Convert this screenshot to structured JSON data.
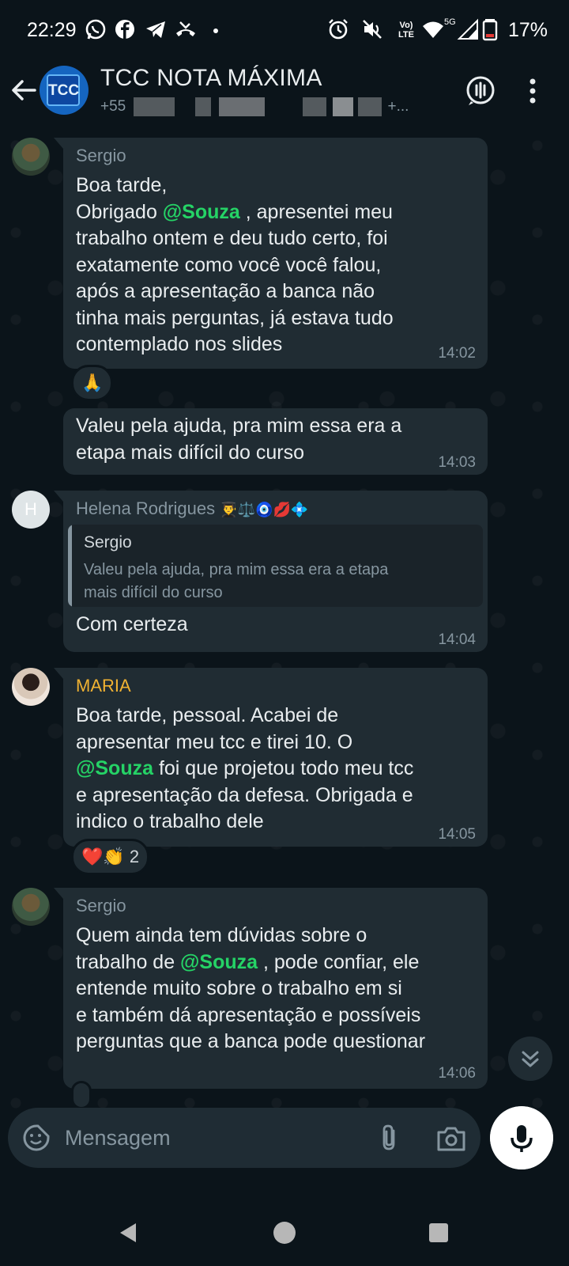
{
  "status_bar": {
    "time": "22:29",
    "battery": "17%",
    "network_label": "Vo) LTE",
    "network_5g": "5G",
    "icons": [
      "whatsapp-icon",
      "facebook-icon",
      "telegram-icon",
      "missed-call-icon",
      "dot-icon",
      "alarm-icon",
      "mute-icon",
      "volte-icon",
      "wifi-icon",
      "signal-icon",
      "battery-icon"
    ]
  },
  "header": {
    "back_icon": "arrow-left-icon",
    "avatar_text": "TCC",
    "title": "TCC NOTA MÁXIMA",
    "members_start": "+55 ",
    "members_end": "+...",
    "call_icon": "voice-call-icon",
    "menu_icon": "more-vertical-icon"
  },
  "messages": [
    {
      "sender": "Sergio",
      "sender_color": "#8696a0",
      "lines": [
        "Boa tarde,",
        "Obrigado ",
        "@Souza",
        " , apresentei meu",
        "trabalho ontem e deu tudo certo, foi",
        "exatamente como você você falou,",
        "após a apresentação a banca não",
        "tinha mais perguntas, já estava tudo",
        "contemplado nos slides"
      ],
      "time": "14:02",
      "reaction": "🙏"
    },
    {
      "sender": "",
      "lines": [
        "Valeu pela ajuda, pra mim essa era a",
        "etapa mais difícil do curso"
      ],
      "time": "14:03"
    },
    {
      "sender": "Helena Rodrigues",
      "sender_emojis": "👨‍🎓⚖️🧿💋💠",
      "sender_color": "#8696a0",
      "avatar_letter": "H",
      "quote_author": "Sergio",
      "quote_lines": [
        "Valeu pela ajuda, pra mim essa era a etapa",
        "mais difícil do curso"
      ],
      "lines": [
        "Com certeza"
      ],
      "time": "14:04"
    },
    {
      "sender": "MARIA",
      "sender_color": "#f0b232",
      "lines": [
        "Boa tarde, pessoal. Acabei de",
        "apresentar meu tcc e tirei 10. O",
        "@Souza",
        " foi que projetou todo meu tcc",
        "e apresentação da defesa. Obrigada e",
        "indico o trabalho dele"
      ],
      "time": "14:05",
      "reaction": "❤️👏",
      "reaction_count": "2"
    },
    {
      "sender": "Sergio",
      "sender_color": "#8696a0",
      "lines": [
        "Quem ainda tem dúvidas sobre o",
        "trabalho de ",
        "@Souza",
        " , pode confiar, ele",
        "entende muito sobre o trabalho em si",
        "e também dá apresentação e possíveis",
        "perguntas que a banca pode questionar"
      ],
      "time": "14:06"
    }
  ],
  "composer": {
    "placeholder": "Mensagem",
    "emoji_icon": "sticker-icon",
    "attach_icon": "paperclip-icon",
    "camera_icon": "camera-icon",
    "mic_icon": "microphone-icon"
  },
  "scroll_icon": "double-chevron-down-icon",
  "nav": {
    "back": "triangle-back-icon",
    "home": "circle-home-icon",
    "recents": "square-recents-icon"
  },
  "colors": {
    "background": "#0b141a",
    "bubble": "#202c33",
    "mention": "#25d366",
    "maria": "#f0b232",
    "meta": "#8696a0"
  }
}
